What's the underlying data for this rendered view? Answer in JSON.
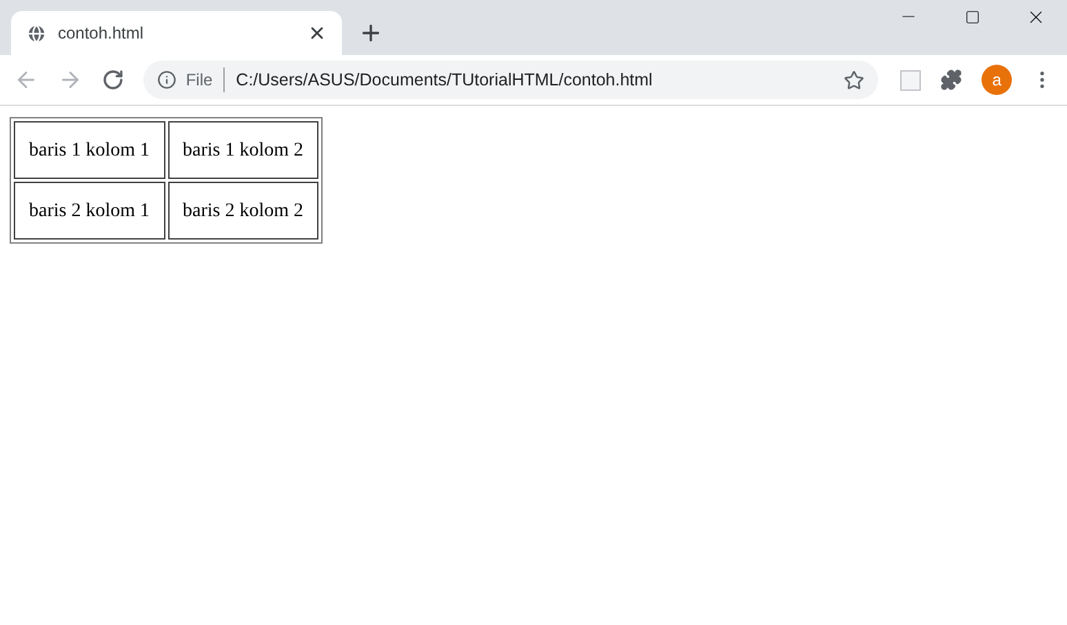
{
  "tab": {
    "title": "contoh.html",
    "selected": true
  },
  "address_bar": {
    "scheme_label": "File",
    "url": "C:/Users/ASUS/Documents/TUtorialHTML/contoh.html"
  },
  "profile": {
    "initial": "a"
  },
  "table": {
    "rows": [
      [
        "baris 1 kolom 1",
        "baris 1 kolom 2"
      ],
      [
        "baris 2 kolom 1",
        "baris 2 kolom 2"
      ]
    ]
  }
}
